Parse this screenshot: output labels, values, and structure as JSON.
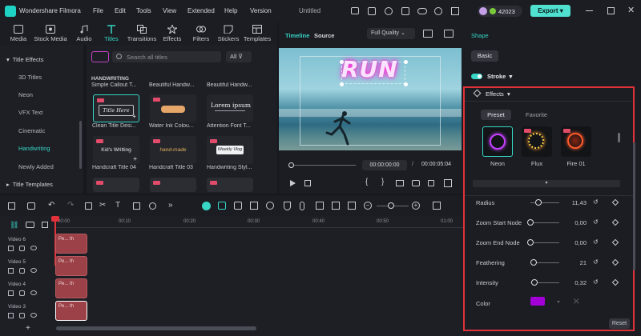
{
  "app": {
    "title": "Wondershare Filmora",
    "document": "Untitled",
    "credits": "42023",
    "export_label": "Export"
  },
  "menu": [
    "File",
    "Edit",
    "Tools",
    "View",
    "Extended",
    "Help",
    "Version"
  ],
  "toolbar": {
    "items": [
      {
        "label": "Media",
        "icon": "media-icon"
      },
      {
        "label": "Stock Media",
        "icon": "stock-media-icon"
      },
      {
        "label": "Audio",
        "icon": "audio-icon"
      },
      {
        "label": "Titles",
        "icon": "titles-icon"
      },
      {
        "label": "Transitions",
        "icon": "transitions-icon"
      },
      {
        "label": "Effects",
        "icon": "effects-icon"
      },
      {
        "label": "Filters",
        "icon": "filters-icon"
      },
      {
        "label": "Stickers",
        "icon": "stickers-icon"
      },
      {
        "label": "Templates",
        "icon": "templates-icon"
      }
    ],
    "active": "Titles"
  },
  "sidebar": {
    "sections": [
      {
        "label": "Title Effects"
      },
      {
        "label": "Title Templates"
      }
    ],
    "items": [
      "3D Titles",
      "Neon",
      "VFX Text",
      "Cinematic",
      "Handwriting",
      "Newly Added"
    ],
    "active": "Handwriting"
  },
  "library": {
    "search_placeholder": "Search all titles",
    "filter_label": "All",
    "category": "HANDWRITING",
    "top_row": [
      "Simple Callout T...",
      "Beautiful Handw...",
      "Beautiful Handw..."
    ],
    "items": [
      {
        "name": "Clean Title Desi...",
        "text": "Title Here"
      },
      {
        "name": "Water Ink Colou...",
        "text": ""
      },
      {
        "name": "Attention Font T...",
        "text": "Lorem ipsum"
      },
      {
        "name": "Handcraft Title 04",
        "text": "Kid's Writting"
      },
      {
        "name": "Handcraft Title 03",
        "text": "hand-made"
      },
      {
        "name": "Handwriting Styl...",
        "text": "Weekly Vlog"
      }
    ]
  },
  "preview": {
    "tabs": [
      "Timeline",
      "Source"
    ],
    "active_tab": "Timeline",
    "quality": "Full Quality",
    "overlay_text": "RUN",
    "current_time": "00:00:00:00",
    "total_time": "00:00:05:04",
    "separator": "/"
  },
  "timeline": {
    "ruler": [
      "00:00",
      "00:10",
      "00:20",
      "00:30",
      "00:40",
      "00:50",
      "01:00"
    ],
    "tracks": [
      {
        "name": "Video 6",
        "clip": "Pe... th"
      },
      {
        "name": "Video 5",
        "clip": "Pe... th"
      },
      {
        "name": "Video 4",
        "clip": "Pe... th"
      },
      {
        "name": "Video 3",
        "clip": "Pe... th"
      }
    ]
  },
  "panel": {
    "tab": "Shape",
    "subtab": "Basic",
    "stroke_label": "Stroke",
    "effects_label": "Effects",
    "effect_tabs": [
      "Preset",
      "Favorite"
    ],
    "active_effect_tab": "Preset",
    "presets": [
      "Neon",
      "Flux",
      "Fire 01"
    ],
    "properties": [
      {
        "label": "Radius",
        "value": "11,43",
        "level": 0.28
      },
      {
        "label": "Zoom Start Node",
        "value": "0,00",
        "level": 0
      },
      {
        "label": "Zoom End Node",
        "value": "0,00",
        "level": 0
      },
      {
        "label": "Feathering",
        "value": "21",
        "level": 0.1
      },
      {
        "label": "Intensity",
        "value": "0,32",
        "level": 0.15
      }
    ],
    "color_label": "Color",
    "color_value": "#a200d6",
    "reset_label": "Reset"
  },
  "colors": {
    "accent": "#37d6c6",
    "highlight": "#e0323a",
    "export": "#4fe0d0",
    "clip": "#9b4147"
  }
}
